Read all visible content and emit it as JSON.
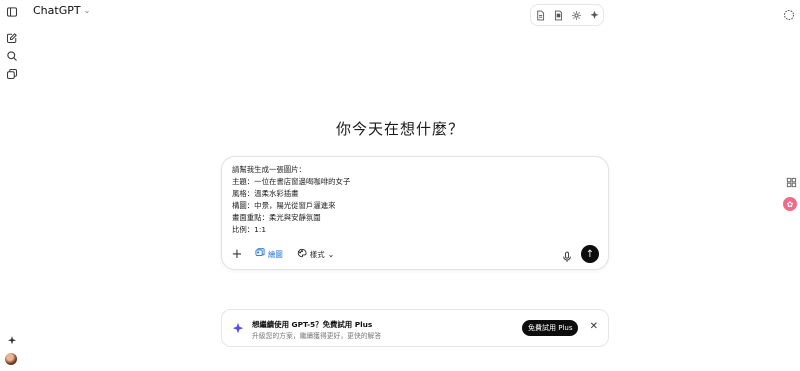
{
  "app": {
    "title": "ChatGPT"
  },
  "main": {
    "heading": "你今天在想什麼？"
  },
  "composer": {
    "prompt_lines": [
      "請幫我生成一張圖片：",
      "主題：一位在書店窗邊喝咖啡的女子",
      "風格：溫柔水彩插畫",
      "構圖：中景，陽光從窗戶灑進來",
      "畫面重點：柔光與安靜氛圍",
      "比例：1:1"
    ],
    "image_tool_label": "繪圖",
    "style_label": "樣式"
  },
  "banner": {
    "title": "想繼續使用 GPT-5？免費試用 Plus",
    "subtitle": "升級您的方案，繼續獲得更好，更快的解答",
    "trial_button": "免費試用 Plus"
  },
  "icons": {
    "sidebar_toggle": "sidebar-toggle-icon",
    "new_chat": "new-chat-icon",
    "search": "search-icon",
    "library": "library-icon",
    "send": "arrow-up-icon"
  },
  "colors": {
    "accent_blue": "#1a6dd9",
    "send_bg": "#0d0d0d",
    "sparkle": "#5b4ce6"
  }
}
